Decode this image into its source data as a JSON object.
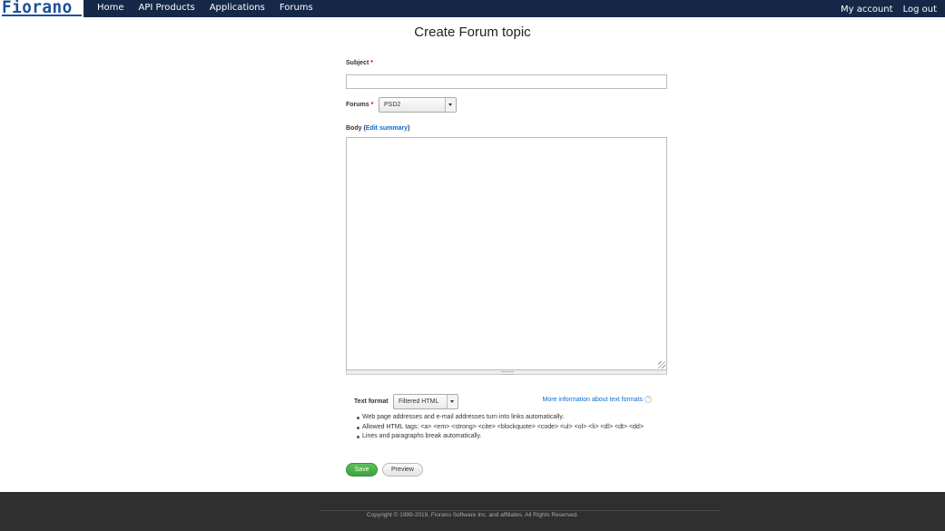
{
  "header": {
    "logo_text": "Fiorano",
    "nav": [
      "Home",
      "API Products",
      "Applications",
      "Forums"
    ],
    "account": [
      "My account",
      "Log out"
    ]
  },
  "page": {
    "title": "Create Forum topic"
  },
  "form": {
    "subject_label": "Subject",
    "subject_value": "",
    "required_mark": "*",
    "forums_label": "Forums",
    "forums_selected": "PSD2",
    "body_label": "Body (",
    "edit_summary": "Edit summary",
    "body_label_close": ")",
    "body_value": "",
    "text_format_label": "Text format",
    "text_format_selected": "Filtered HTML",
    "more_info": "More information about text formats",
    "help_glyph": "?",
    "tips": [
      "Web page addresses and e-mail addresses turn into links automatically.",
      "Allowed HTML tags: <a> <em> <strong> <cite> <blockquote> <code> <ul> <ol> <li> <dl> <dt> <dd>",
      "Lines and paragraphs break automatically."
    ],
    "save_label": "Save",
    "preview_label": "Preview"
  },
  "footer": {
    "copyright": "Copyright © 1999-2019, Fiorano Software Inc. and affiliates. All Rights Reserved."
  },
  "colors": {
    "topbar": "#152848",
    "logo": "#1d4f9c",
    "link": "#0a6ccd",
    "save": "#3da03d",
    "footer": "#2f2f2f"
  }
}
